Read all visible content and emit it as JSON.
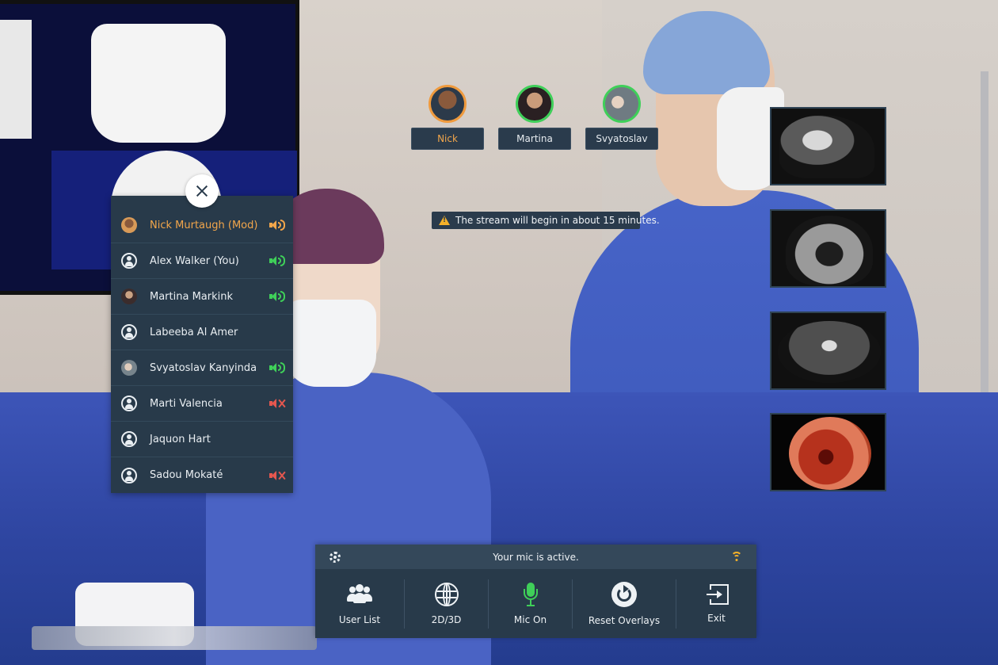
{
  "avatars": [
    {
      "name": "Nick",
      "role": "moderator"
    },
    {
      "name": "Martina",
      "role": "speaking"
    },
    {
      "name": "Svyatoslav",
      "role": "speaking"
    }
  ],
  "notice": {
    "text": "The stream will begin in about 15 minutes.",
    "icon": "warning-icon"
  },
  "user_list": {
    "users": [
      {
        "name": "Nick Murtaugh (Mod)",
        "avatar": "photo",
        "audio": "speaking-orange"
      },
      {
        "name": "Alex Walker (You)",
        "avatar": "generic",
        "audio": "speaking-green"
      },
      {
        "name": "Martina Markink",
        "avatar": "photo",
        "audio": "speaking-green"
      },
      {
        "name": "Labeeba Al Amer",
        "avatar": "generic",
        "audio": "none"
      },
      {
        "name": "Svyatoslav Kanyinda",
        "avatar": "photo",
        "audio": "speaking-green"
      },
      {
        "name": "Marti Valencia",
        "avatar": "generic",
        "audio": "muted"
      },
      {
        "name": "Jaquon Hart",
        "avatar": "generic",
        "audio": "none"
      },
      {
        "name": "Sadou Mokaté",
        "avatar": "generic",
        "audio": "muted"
      }
    ]
  },
  "toolbar": {
    "status": "Your mic is active.",
    "buttons": [
      {
        "label": "User List",
        "icon": "users-icon"
      },
      {
        "label": "2D/3D",
        "icon": "globe-icon"
      },
      {
        "label": "Mic On",
        "icon": "mic-icon"
      },
      {
        "label": "Reset Overlays",
        "icon": "reset-icon"
      },
      {
        "label": "Exit",
        "icon": "exit-icon"
      }
    ]
  },
  "colors": {
    "panel": "#283a4a",
    "moderator": "#f2a64b",
    "active": "#3fcf59",
    "muted": "#e5574f",
    "warning": "#f5b129"
  }
}
